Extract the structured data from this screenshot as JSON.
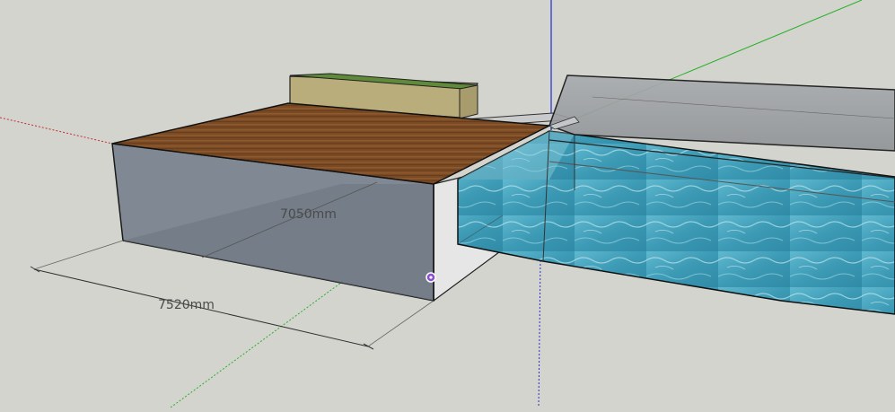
{
  "dimensions": {
    "depth_label": "7050mm",
    "width_label": "7520mm"
  },
  "colors": {
    "background": "#d4d4cf",
    "deck_wood": "#7a4a24",
    "box_side": "#7c8690",
    "water": "#3c9ab5",
    "glass": "#9a9ea2",
    "planter_grass": "#5f8a3a",
    "planter_stone": "#b9ad7c",
    "axis_red": "#c03030",
    "axis_green": "#28b028",
    "axis_blue": "#2030d0",
    "inference_point": "#8a4fd0"
  },
  "scene": {
    "objects": [
      "deck-box",
      "planter",
      "pool",
      "glass-roof",
      "axes",
      "dimension-lines",
      "inference-point"
    ]
  }
}
